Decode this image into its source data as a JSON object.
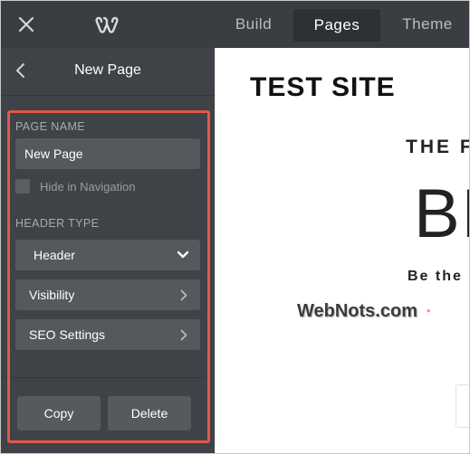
{
  "topbar": {
    "close_icon": "close-icon",
    "logo_icon": "weebly-logo-icon",
    "tabs": [
      {
        "label": "Build",
        "active": false
      },
      {
        "label": "Pages",
        "active": true
      },
      {
        "label": "Theme",
        "active": false
      }
    ]
  },
  "sidebar": {
    "title": "New Page",
    "back_icon": "chevron-left-icon",
    "page_name_label": "PAGE NAME",
    "page_name_value": "New Page",
    "hide_nav_label": "Hide in Navigation",
    "hide_nav_checked": false,
    "header_type_label": "HEADER TYPE",
    "header_type_value": "Header",
    "visibility_label": "Visibility",
    "seo_label": "SEO Settings",
    "copy_label": "Copy",
    "delete_label": "Delete"
  },
  "canvas": {
    "site_name": "TEST SITE",
    "hero_small": "THE F",
    "hero_big": "BE",
    "hero_sub": "Be the",
    "watermark": "WebNots.com"
  },
  "colors": {
    "topbar_bg": "#3a3d41",
    "sidebar_bg": "#3f4246",
    "field_bg": "#55595d",
    "highlight": "#e1584b"
  }
}
